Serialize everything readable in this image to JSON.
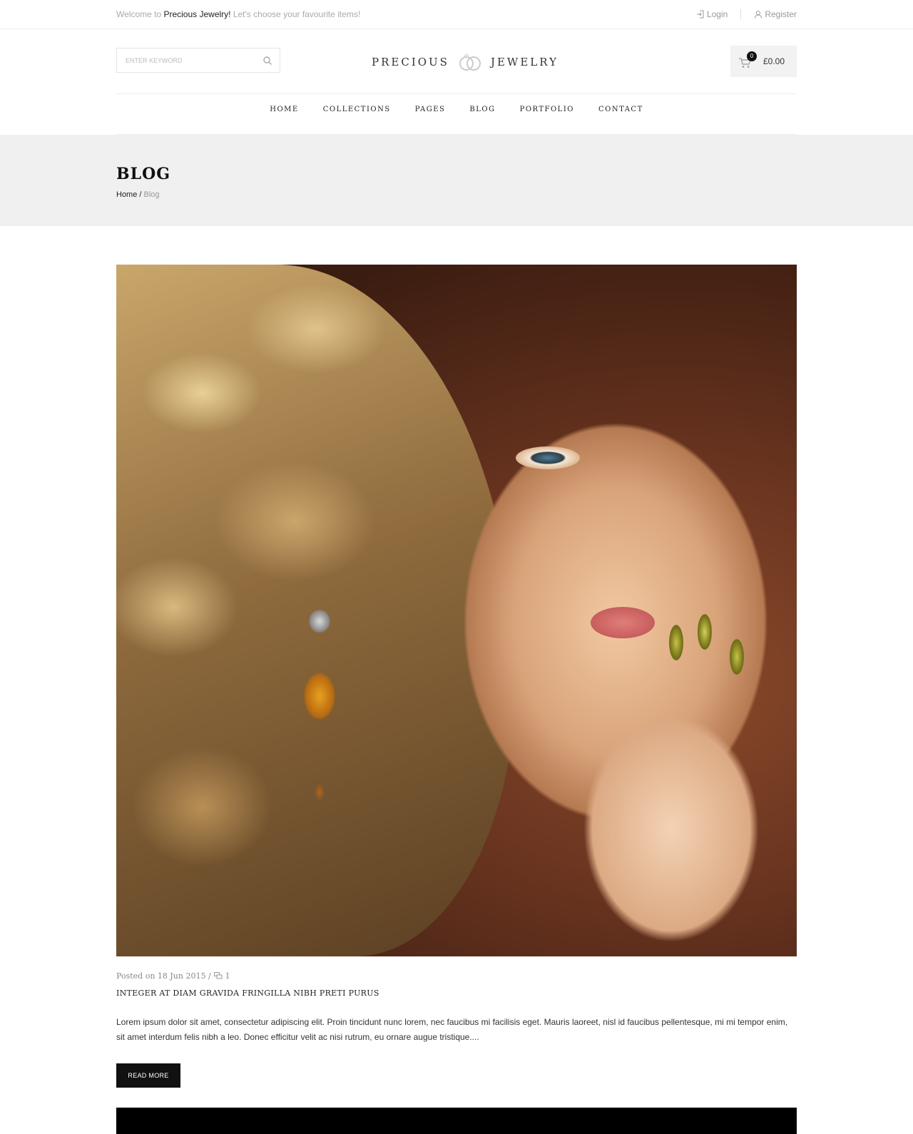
{
  "topbar": {
    "welcome_prefix": "Welcome to ",
    "store_name": "Precious Jewelry!",
    "welcome_suffix": " Let's choose your favourite items!",
    "login_label": "Login",
    "register_label": "Register"
  },
  "header": {
    "search_placeholder": "ENTER KEYWORD",
    "logo_left": "PRECIOUS",
    "logo_right": "JEWELRY",
    "cart_count": "0",
    "cart_total": "£0.00"
  },
  "nav": {
    "items": [
      "HOME",
      "COLLECTIONS",
      "PAGES",
      "BLOG",
      "PORTFOLIO",
      "CONTACT"
    ]
  },
  "page": {
    "title": "BLOG",
    "breadcrumb_home": "Home",
    "breadcrumb_sep": " / ",
    "breadcrumb_current": "Blog"
  },
  "post": {
    "meta_posted": "Posted on 18 Jun 2015 / ",
    "comment_count": "1",
    "title": "INTEGER AT DIAM GRAVIDA FRINGILLA NIBH PRETI PURUS",
    "excerpt": "Lorem ipsum dolor sit amet, consectetur adipiscing elit. Proin tincidunt nunc lorem, nec faucibus mi facilisis eget. Mauris laoreet, nisl id faucibus pellentesque, mi mi tempor enim, sit amet interdum felis nibh a leo. Donec efficitur velit ac nisi rutrum, eu ornare augue tristique....",
    "read_more_label": "READ MORE"
  },
  "icons": {
    "login": "login-icon",
    "register": "user-icon",
    "search": "search-icon",
    "logo": "rings-icon",
    "cart": "cart-icon",
    "comment": "comment-icon"
  }
}
